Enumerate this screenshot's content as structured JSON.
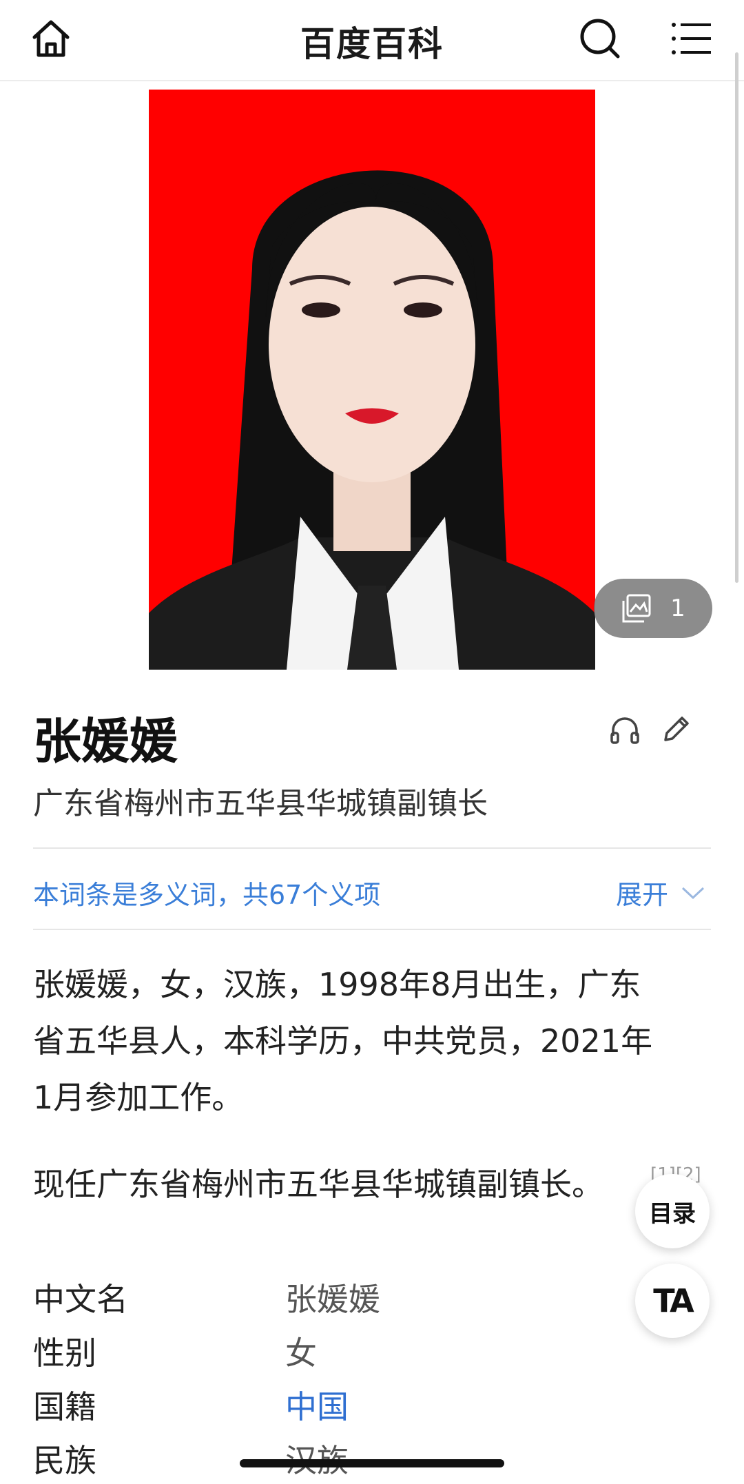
{
  "header": {
    "title": "百度百科"
  },
  "image": {
    "count": "1"
  },
  "entry": {
    "name": "张媛媛",
    "subtitle": "广东省梅州市五华县华城镇副镇长",
    "polysemy_text": "本词条是多义词，共67个义项",
    "expand_label": "展开"
  },
  "summary": {
    "para1_line1": "张媛媛，女，汉族，1998年8月出生，广东",
    "para1_line2": "省五华县人，本科学历，中共党员，2021年",
    "para1_line3": "1月参加工作。",
    "para2": "现任广东省梅州市五华县华城镇副镇长。",
    "ref": "[1][2]"
  },
  "floating": {
    "toc_label": "目录",
    "ta_label": "TA"
  },
  "basic_info": [
    {
      "key": "中文名",
      "value": "张媛媛"
    },
    {
      "key": "性别",
      "value": "女"
    },
    {
      "key": "国籍",
      "value": "中国"
    },
    {
      "key": "民族",
      "value": "汉族"
    }
  ],
  "colors": {
    "accent_link": "#3a7ed8",
    "photo_background": "#ff0000"
  }
}
